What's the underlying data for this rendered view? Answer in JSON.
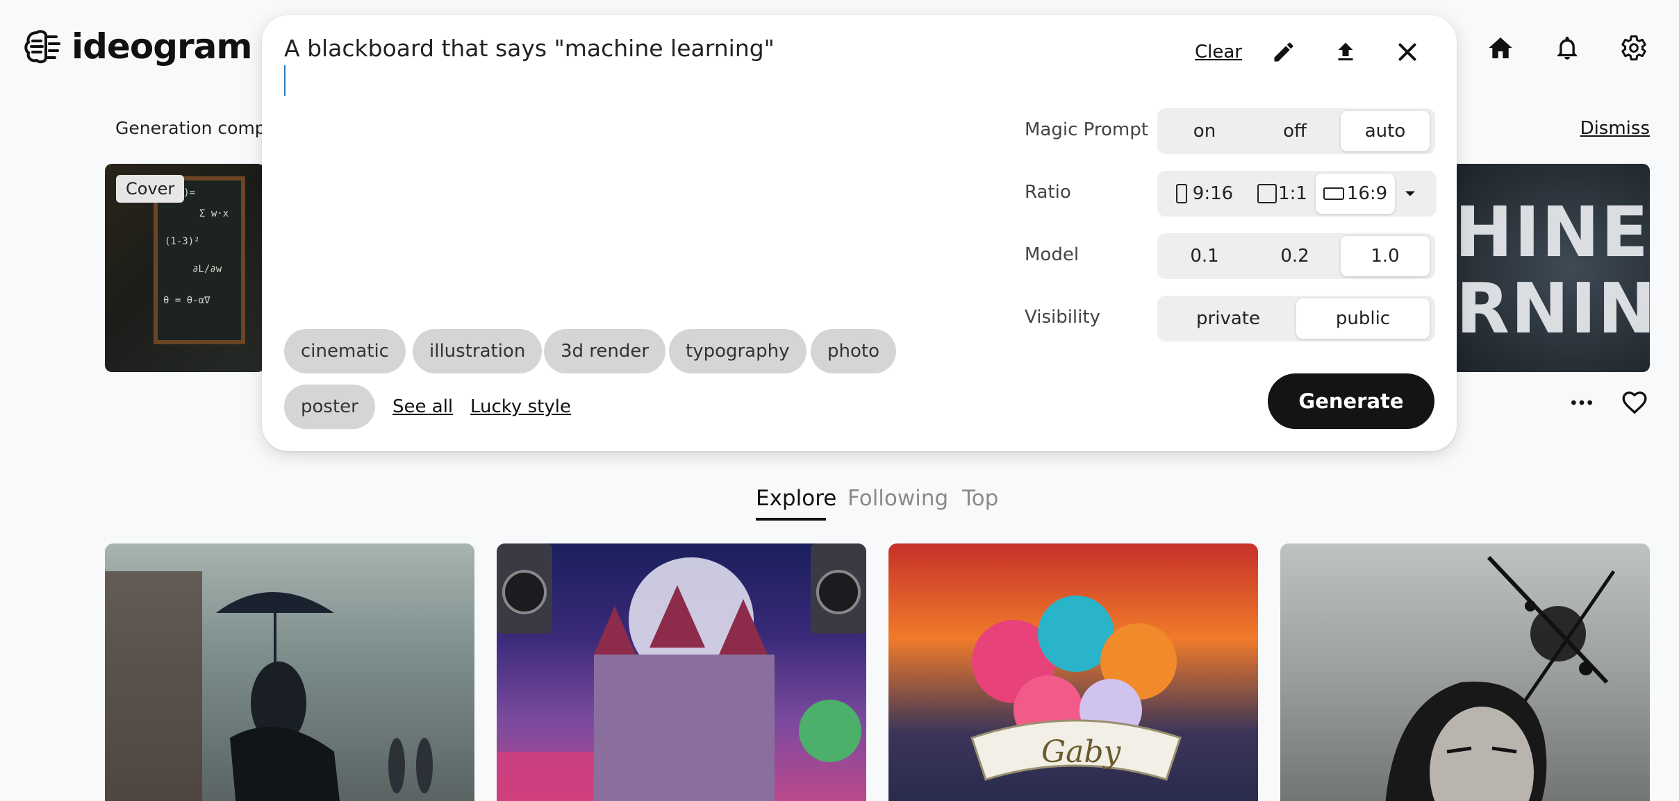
{
  "brand": {
    "name": "ideogram"
  },
  "notification": {
    "text": "Generation comp",
    "dismiss_label": "Dismiss",
    "cover_badge": "Cover"
  },
  "background_image": {
    "text_line1": "HINE",
    "text_line2": "RNING"
  },
  "prompt": {
    "value": "A blackboard that says \"machine learning\"",
    "clear_label": "Clear"
  },
  "options": {
    "magic_prompt": {
      "label": "Magic Prompt",
      "choices": [
        "on",
        "off",
        "auto"
      ],
      "selected": "auto"
    },
    "ratio": {
      "label": "Ratio",
      "choices": [
        "9:16",
        "1:1",
        "16:9"
      ],
      "selected": "16:9"
    },
    "model": {
      "label": "Model",
      "choices": [
        "0.1",
        "0.2",
        "1.0"
      ],
      "selected": "1.0"
    },
    "visibility": {
      "label": "Visibility",
      "choices": [
        "private",
        "public"
      ],
      "selected": "public"
    }
  },
  "styles": [
    "cinematic",
    "illustration",
    "3d render",
    "typography",
    "photo",
    "poster"
  ],
  "style_links": {
    "see_all": "See all",
    "lucky": "Lucky style"
  },
  "generate_label": "Generate",
  "tabs": [
    {
      "label": "Explore",
      "active": true
    },
    {
      "label": "Following",
      "active": false
    },
    {
      "label": "Top",
      "active": false
    }
  ],
  "gallery_text": {
    "gaby": "Gaby"
  },
  "cover_chalk": [
    "f(x)=",
    "Σ w·x",
    "(1-3)²",
    "∂L/∂w",
    "θ = θ-α∇"
  ],
  "colors": {
    "generate_bg": "#141414",
    "caret": "#2d7ab8",
    "chip_bg": "#d5d5d5"
  }
}
